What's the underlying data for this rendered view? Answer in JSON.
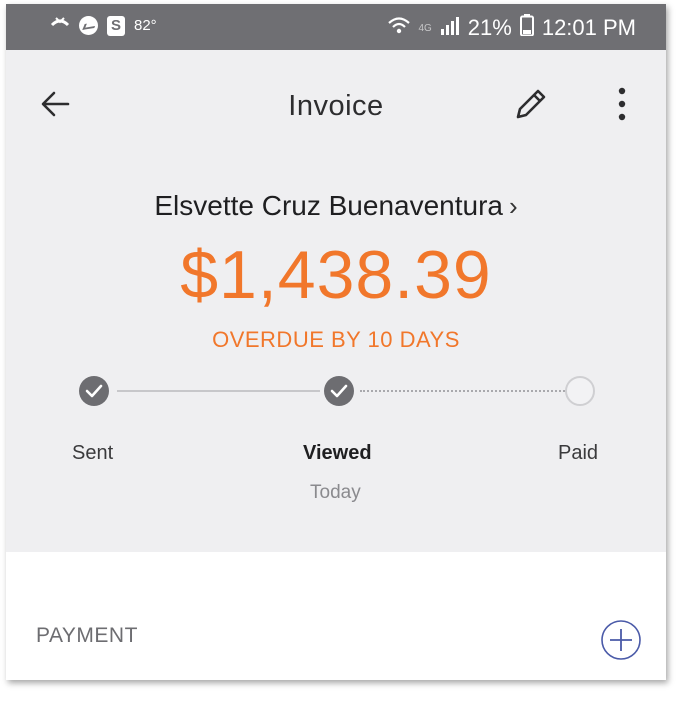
{
  "status_bar": {
    "temperature": "82°",
    "battery": "21%",
    "time": "12:01 PM",
    "network": "4G",
    "icons": [
      "missed-call-icon",
      "messenger-icon",
      "s-app-icon",
      "wifi-icon",
      "signal-icon",
      "battery-icon"
    ]
  },
  "header": {
    "title": "Invoice"
  },
  "invoice": {
    "customer": "Elsvette Cruz Buenaventura",
    "amount": "$1,438.39",
    "status": "OVERDUE BY 10 DAYS"
  },
  "progress": {
    "steps": [
      {
        "label": "Sent",
        "completed": true,
        "sub": ""
      },
      {
        "label": "Viewed",
        "completed": true,
        "sub": "Today"
      },
      {
        "label": "Paid",
        "completed": false,
        "sub": ""
      }
    ]
  },
  "payment": {
    "label": "PAYMENT"
  },
  "colors": {
    "accent": "#f1772b",
    "status_bar": "#6f6f73",
    "step_done": "#6d6d71"
  }
}
